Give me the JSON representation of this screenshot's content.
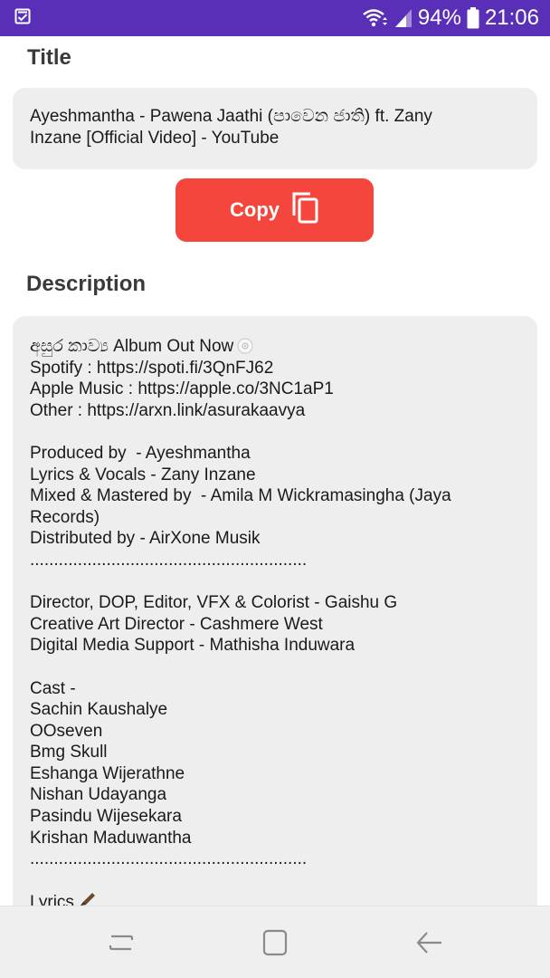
{
  "status_bar": {
    "battery": "94%",
    "time": "21:06",
    "icons": [
      "task-check-icon",
      "wifi-icon",
      "signal-icon",
      "battery-icon"
    ]
  },
  "title_section": {
    "heading": "Title",
    "text_lines": [
      "Ayeshmantha - Pawena Jaathi (පාවෙන ජාති) ft. Zany",
      "Inzane [Official Video] - YouTube"
    ]
  },
  "copy_button": {
    "label": "Copy",
    "icon": "copy-icon"
  },
  "description_section": {
    "heading": "Description",
    "lines": [
      "අසුර කාව්‍ය Album Out Now",
      "Spotify : https://spoti.fi/3QnFJ62",
      "Apple Music : https://apple.co/3NC1aP1",
      "Other : https://arxn.link/asurakaavya",
      "",
      "Produced by  - Ayeshmantha",
      "Lyrics & Vocals - Zany Inzane",
      "Mixed & Mastered by  - Amila M Wickramasingha (Jaya",
      "Records)",
      "Distributed by - AirXone Musik",
      "..........................................................",
      "",
      "Director, DOP, Editor, VFX & Colorist - Gaishu G",
      "Creative Art Director - Cashmere West",
      "Digital Media Support - Mathisha Induwara",
      "",
      "Cast -",
      "Sachin Kaushalye",
      "OOseven",
      "Bmg Skull",
      "Eshanga Wijerathne",
      "Nishan Udayanga",
      "Pasindu Wijesekara",
      "Krishan Maduwantha",
      "..........................................................",
      "",
      "Lyrics"
    ]
  },
  "nav_bar": {
    "buttons": [
      "recent-apps",
      "home",
      "back"
    ]
  },
  "colors": {
    "status_bar": "#5a2fb8",
    "copy_button": "#f5463d",
    "card_background": "#eeeeee",
    "nav_bar": "#efefef"
  }
}
